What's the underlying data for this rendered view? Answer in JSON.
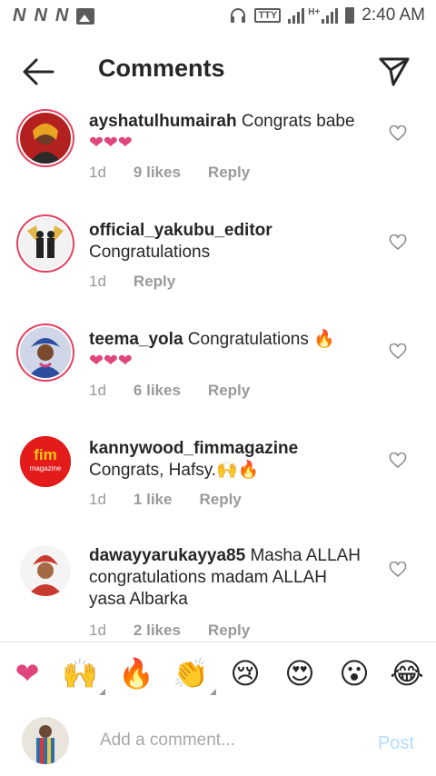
{
  "status_bar": {
    "notifications": [
      "N",
      "N",
      "N"
    ],
    "network": "H+",
    "tty": "TTY",
    "time": "2:40 AM"
  },
  "header": {
    "title": "Comments",
    "back_icon": "arrow-left-icon",
    "send_icon": "send-icon"
  },
  "comments": [
    {
      "username": "ayshatulhumairah",
      "text": " Congrats babe",
      "hearts": "❤❤❤",
      "time": "1d",
      "likes": "9 likes",
      "reply": "Reply"
    },
    {
      "username": "official_yakubu_editor",
      "text": " Congratulations",
      "hearts": "",
      "time": "1d",
      "likes": "",
      "reply": "Reply"
    },
    {
      "username": "teema_yola",
      "text": " Congratulations 🔥",
      "hearts": "❤❤❤",
      "time": "1d",
      "likes": "6 likes",
      "reply": "Reply"
    },
    {
      "username": "kannywood_fimmagazine",
      "text": " Congrats, Hafsy.🙌🔥",
      "hearts": "",
      "time": "1d",
      "likes": "1 like",
      "reply": "Reply"
    },
    {
      "username": "dawayyarukayya85",
      "text": " Masha ALLAH congratulations madam ALLAH yasa Albarka",
      "hearts": "",
      "time": "1d",
      "likes": "2 likes",
      "reply": "Reply"
    }
  ],
  "avatars": {
    "fim_logo_text": "fim",
    "fim_logo_sub": "magazine"
  },
  "emoji_bar": [
    "❤",
    "🙌",
    "🔥",
    "👏",
    "😢",
    "😍",
    "😮",
    "😂"
  ],
  "compose": {
    "placeholder": "Add a comment...",
    "post_label": "Post"
  },
  "colors": {
    "accent_heart": "#e0457b",
    "post_disabled": "#b3dbff",
    "meta_gray": "#9a9a9a"
  }
}
